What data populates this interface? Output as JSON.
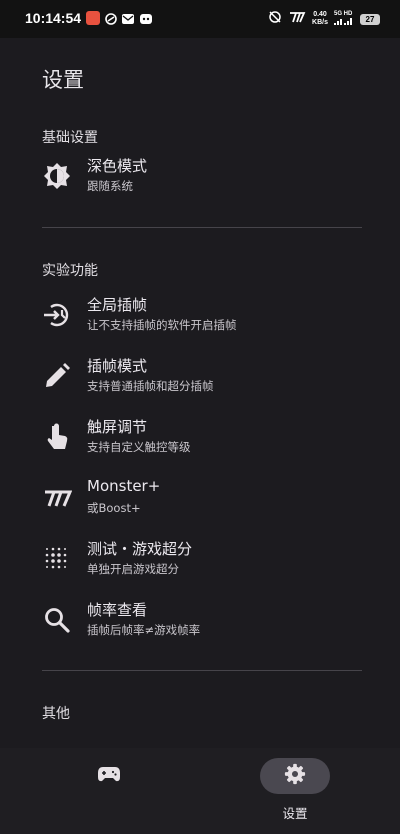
{
  "status_bar": {
    "time": "10:14:54",
    "net_speed_value": "0.40",
    "net_speed_unit": "KB/s",
    "signal_top": "5G HD",
    "battery": "27",
    "notif_colors": [
      "#e8523f",
      "#ffffff",
      "#ffffff",
      "#ffffff"
    ]
  },
  "page": {
    "title": "设置"
  },
  "sections": [
    {
      "title": "基础设置",
      "items": [
        {
          "icon": "brightness-icon",
          "title": "深色模式",
          "subtitle": "跟随系统"
        }
      ]
    },
    {
      "title": "实验功能",
      "items": [
        {
          "icon": "global-frame-icon",
          "title": "全局插帧",
          "subtitle": "让不支持插帧的软件开启插帧"
        },
        {
          "icon": "pencil-icon",
          "title": "插帧模式",
          "subtitle": "支持普通插帧和超分插帧"
        },
        {
          "icon": "touch-icon",
          "title": "触屏调节",
          "subtitle": "支持自定义触控等级"
        },
        {
          "icon": "monster-icon",
          "title": "Monster+",
          "subtitle": "或Boost+"
        },
        {
          "icon": "dots-grid-icon",
          "title": "测试・游戏超分",
          "subtitle": "单独开启游戏超分"
        },
        {
          "icon": "search-icon",
          "title": "帧率查看",
          "subtitle": "插帧后帧率≠游戏帧率"
        }
      ]
    },
    {
      "title": "其他",
      "items": []
    }
  ],
  "bottom_nav": {
    "items": [
      {
        "icon": "gamepad-icon",
        "label": "",
        "active": false
      },
      {
        "icon": "gear-icon",
        "label": "设置",
        "active": true
      }
    ]
  },
  "colors": {
    "background": "#1c1b1f",
    "active_pill": "#4a4850",
    "divider": "#46444a"
  }
}
